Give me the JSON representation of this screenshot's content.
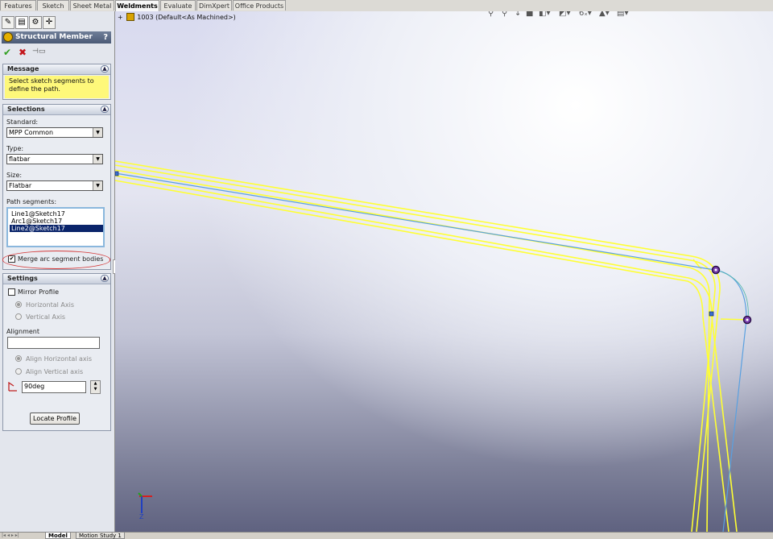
{
  "command_tabs": [
    "Features",
    "Sketch",
    "Sheet Metal",
    "Weldments",
    "Evaluate",
    "DimXpert",
    "Office Products"
  ],
  "active_tab": "Weldments",
  "feature_manager": {
    "tab_icons": [
      "feature-tree-icon",
      "property-manager-icon",
      "configuration-manager-icon",
      "dimxpert-manager-icon"
    ]
  },
  "property_manager": {
    "title": "Structural Member",
    "help": "?",
    "ok": "✔",
    "cancel": "✖",
    "pushpin": "⊣▭",
    "message": {
      "header": "Message",
      "text": "Select sketch segments to define the path."
    },
    "selections": {
      "header": "Selections",
      "standard_label": "Standard:",
      "standard_value": "MPP Common",
      "type_label": "Type:",
      "type_value": "flatbar",
      "size_label": "Size:",
      "size_value": "Flatbar",
      "path_label": "Path segments:",
      "path_segments": [
        "Line1@Sketch17",
        "Arc1@Sketch17",
        "Line2@Sketch17"
      ],
      "selected_segment": "Line2@Sketch17",
      "merge_label": "Merge arc segment bodies",
      "merge_checked": true
    },
    "settings": {
      "header": "Settings",
      "mirror_label": "Mirror Profile",
      "mirror_checked": false,
      "horizontal_axis": "Horizontal Axis",
      "vertical_axis": "Vertical Axis",
      "alignment_label": "Alignment",
      "alignment_value": "",
      "align_horizontal": "Align Horizontal axis",
      "align_vertical": "Align Vertical axis",
      "angle_value": "90deg",
      "locate_button": "Locate Profile"
    }
  },
  "graphics": {
    "tree_expand": "+",
    "tree_item": "1003  (Default<As Machined>)",
    "triad_z": "Z"
  },
  "bottom_tabs": [
    "Model",
    "Motion Study 1"
  ],
  "active_bottom_tab": "Model",
  "colors": {
    "accent": "#fef87a",
    "selection": "#0a246a",
    "path": "#5aa0e0",
    "member": "#ffff33"
  }
}
